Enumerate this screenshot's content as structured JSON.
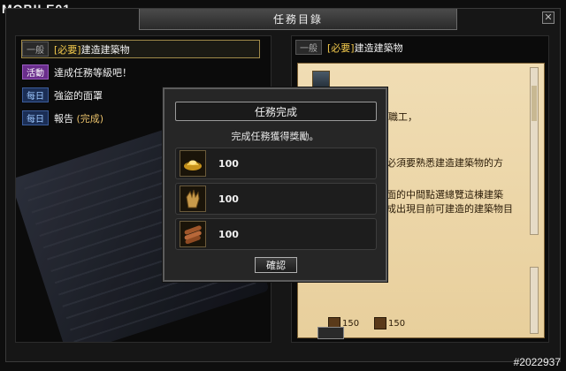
{
  "watermark": {
    "logo": "MOBILE01",
    "post_id": "#2022937"
  },
  "window": {
    "title": "任務目錄",
    "close_glyph": "✕"
  },
  "quests": [
    {
      "tag": "一般",
      "tag_type": "normal",
      "title_prefix": "[必要]",
      "title": "建造建築物",
      "status": ""
    },
    {
      "tag": "活動",
      "tag_type": "event",
      "title_prefix": "",
      "title": "達成任務等級吧！",
      "status": ""
    },
    {
      "tag": "每日",
      "tag_type": "daily",
      "title_prefix": "",
      "title": "強盜的面罩",
      "status": ""
    },
    {
      "tag": "每日",
      "tag_type": "daily",
      "title_prefix": "",
      "title": "報告",
      "status": "(完成)"
    }
  ],
  "detail": {
    "tag": "一般",
    "title_prefix": "[必要]",
    "title": "建造建築物",
    "text_lines": [
      "職工，",
      "必須要熟悉建造建築物的方",
      "面的中間點選總覽這棟建築",
      "成出現目前可建造的建築物目"
    ],
    "reward_values": [
      "150",
      "150"
    ]
  },
  "modal": {
    "title": "任務完成",
    "subtitle": "完成任務獲得獎勵。",
    "rewards": [
      {
        "icon": "gold-ingot-icon",
        "value": "100"
      },
      {
        "icon": "gauntlet-icon",
        "value": "100"
      },
      {
        "icon": "wood-logs-icon",
        "value": "100"
      }
    ],
    "confirm_label": "確認"
  }
}
